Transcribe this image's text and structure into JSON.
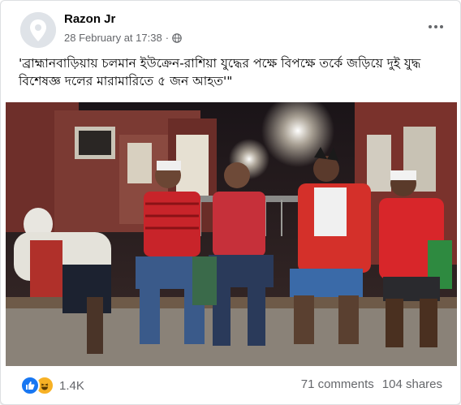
{
  "post": {
    "author": "Razon Jr",
    "timestamp": "28 February at 17:38",
    "separator": "·",
    "privacy_icon": "globe-icon",
    "more_icon": "more-options-icon",
    "caption": "'ব্রাহ্মানবাড়িয়ায় চলমান ইউক্রেন-রাশিয়া যুদ্ধের পক্ষে বিপক্ষে তর্কে জড়িয়ে দুই যুদ্ধ বিশেষজ্ঞ দলের মারামারিতে ৫ জন আহত'\""
  },
  "photo": {
    "description_icon": "post-photo"
  },
  "footer": {
    "reaction_icons": [
      "like-icon",
      "haha-icon"
    ],
    "reaction_count": "1.4K",
    "comments": "71 comments",
    "shares": "104 shares"
  },
  "colors": {
    "brand_blue": "#1877f2",
    "haha_yellow": "#f7b125",
    "secondary_text": "#65676b",
    "primary_text": "#050505"
  }
}
